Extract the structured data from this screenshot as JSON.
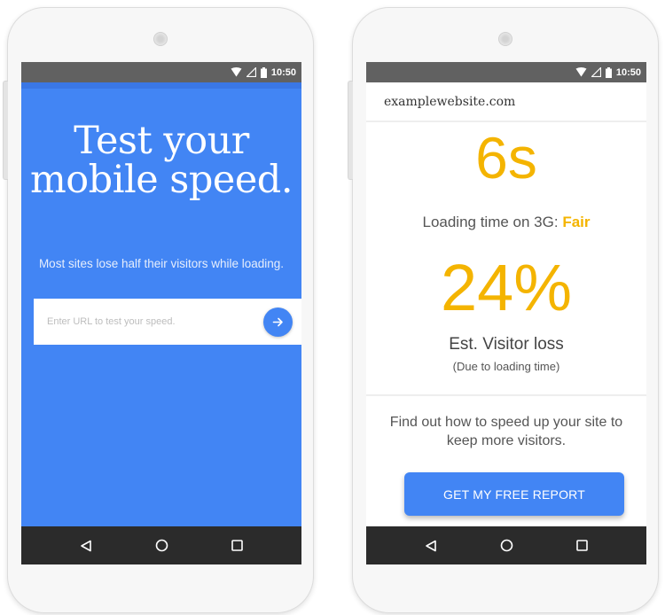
{
  "status_bar": {
    "time": "10:50"
  },
  "left_screen": {
    "headline_line1": "Test your",
    "headline_line2": "mobile speed.",
    "subtitle": "Most sites lose half their visitors while loading.",
    "url_input": {
      "placeholder": "Enter URL to test your speed.",
      "value": ""
    },
    "submit_icon": "arrow-right-icon"
  },
  "right_screen": {
    "site_url": "examplewebsite.com",
    "load_time": "6s",
    "loading_label": "Loading time on 3G: ",
    "rating": "Fair",
    "visitor_loss": "24%",
    "loss_label": "Est. Visitor loss",
    "loss_note": "(Due to loading time)",
    "cta_text": "Find out how to speed up your site to keep more visitors.",
    "cta_button": "GET MY FREE REPORT"
  },
  "nav_bar": {
    "icons": [
      "back-icon",
      "home-icon",
      "recents-icon"
    ]
  },
  "colors": {
    "primary_blue": "#4285f4",
    "accent_yellow": "#f4b400",
    "status_bar": "#616161",
    "nav_bar": "#2b2b2b"
  }
}
